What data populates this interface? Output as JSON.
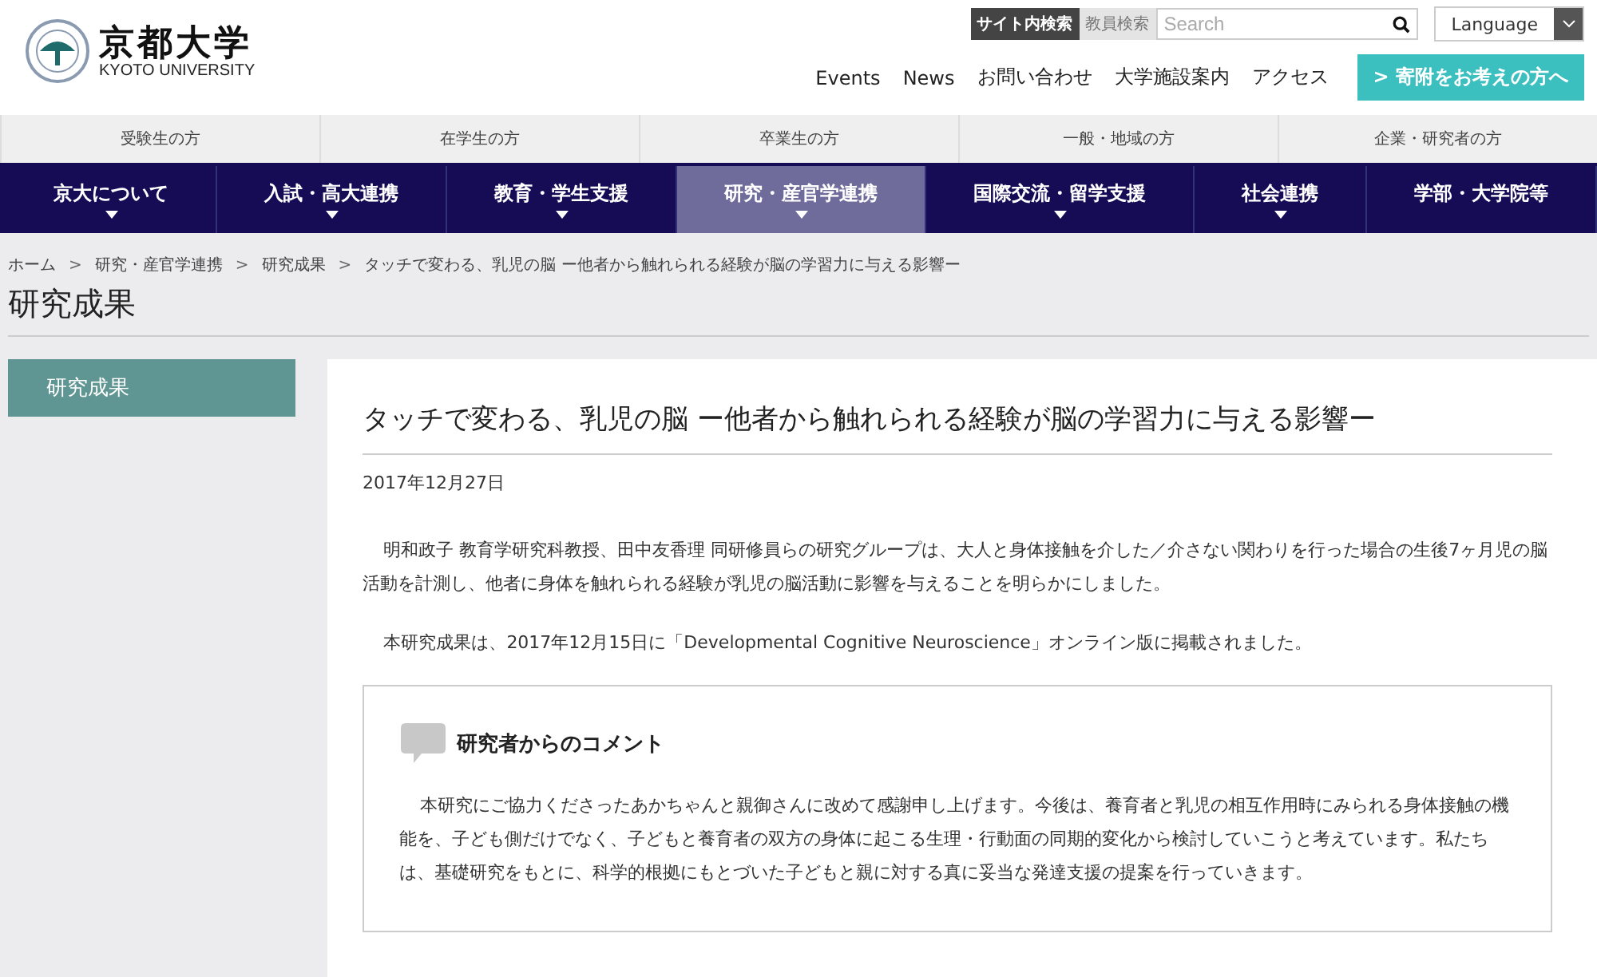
{
  "header": {
    "logo_title": "京都大学",
    "logo_subtitle": "KYOTO UNIVERSITY",
    "search_tabs": [
      {
        "label": "サイト内検索",
        "selected": true
      },
      {
        "label": "教員検索",
        "selected": false
      }
    ],
    "search": {
      "placeholder": "Search"
    },
    "language": "Language",
    "links": [
      "Events",
      "News",
      "お問い合わせ",
      "大学施設案内",
      "アクセス"
    ],
    "donate_arrow": ">",
    "donate": "寄附をお考えの方へ"
  },
  "audience_nav": [
    "受験生の方",
    "在学生の方",
    "卒業生の方",
    "一般・地域の方",
    "企業・研究者の方"
  ],
  "main_nav": [
    {
      "label": "京大について",
      "selected": false,
      "dropdown": true
    },
    {
      "label": "入試・高大連携",
      "selected": false,
      "dropdown": true
    },
    {
      "label": "教育・学生支援",
      "selected": false,
      "dropdown": true
    },
    {
      "label": "研究・産官学連携",
      "selected": true,
      "dropdown": true
    },
    {
      "label": "国際交流・留学支援",
      "selected": false,
      "dropdown": true
    },
    {
      "label": "社会連携",
      "selected": false,
      "dropdown": true
    },
    {
      "label": "学部・大学院等",
      "selected": false,
      "dropdown": false
    }
  ],
  "breadcrumb": [
    {
      "label": "ホーム",
      "separator": ">"
    },
    {
      "label": "研究・産官学連携",
      "separator": ">"
    },
    {
      "label": "研究成果",
      "separator": ">"
    },
    {
      "label": "タッチで変わる、乳児の脳 ー他者から触れられる経験が脳の学習力に与える影響ー"
    }
  ],
  "page_title": "研究成果",
  "sidebar": {
    "items": [
      {
        "label": "研究成果",
        "selected": true
      }
    ]
  },
  "article": {
    "title": "タッチで変わる、乳児の脳 ー他者から触れられる経験が脳の学習力に与える影響ー",
    "date": "2017年12月27日",
    "paragraphs": [
      "明和政子 教育学研究科教授、田中友香理 同研修員らの研究グループは、大人と身体接触を介した／介さない関わりを行った場合の生後7ヶ月児の脳活動を計測し、他者に身体を触れられる経験が乳児の脳活動に影響を与えることを明らかにしました。",
      "本研究成果は、2017年12月15日に「Developmental Cognitive Neuroscience」オンライン版に掲載されました。"
    ],
    "comment": {
      "heading": "研究者からのコメント",
      "text": "本研究にご協力くださったあかちゃんと親御さんに改めて感謝申し上げます。今後は、養育者と乳児の相互作用時にみられる身体接触の機能を、子ども側だけでなく、子どもと養育者の双方の身体に起こる生理・行動面の同期的変化から検討していこうと考えています。私たちは、基礎研究をもとに、科学的根拠にもとづいた子どもと親に対する真に妥当な発達支援の提案を行っていきます。"
    }
  }
}
